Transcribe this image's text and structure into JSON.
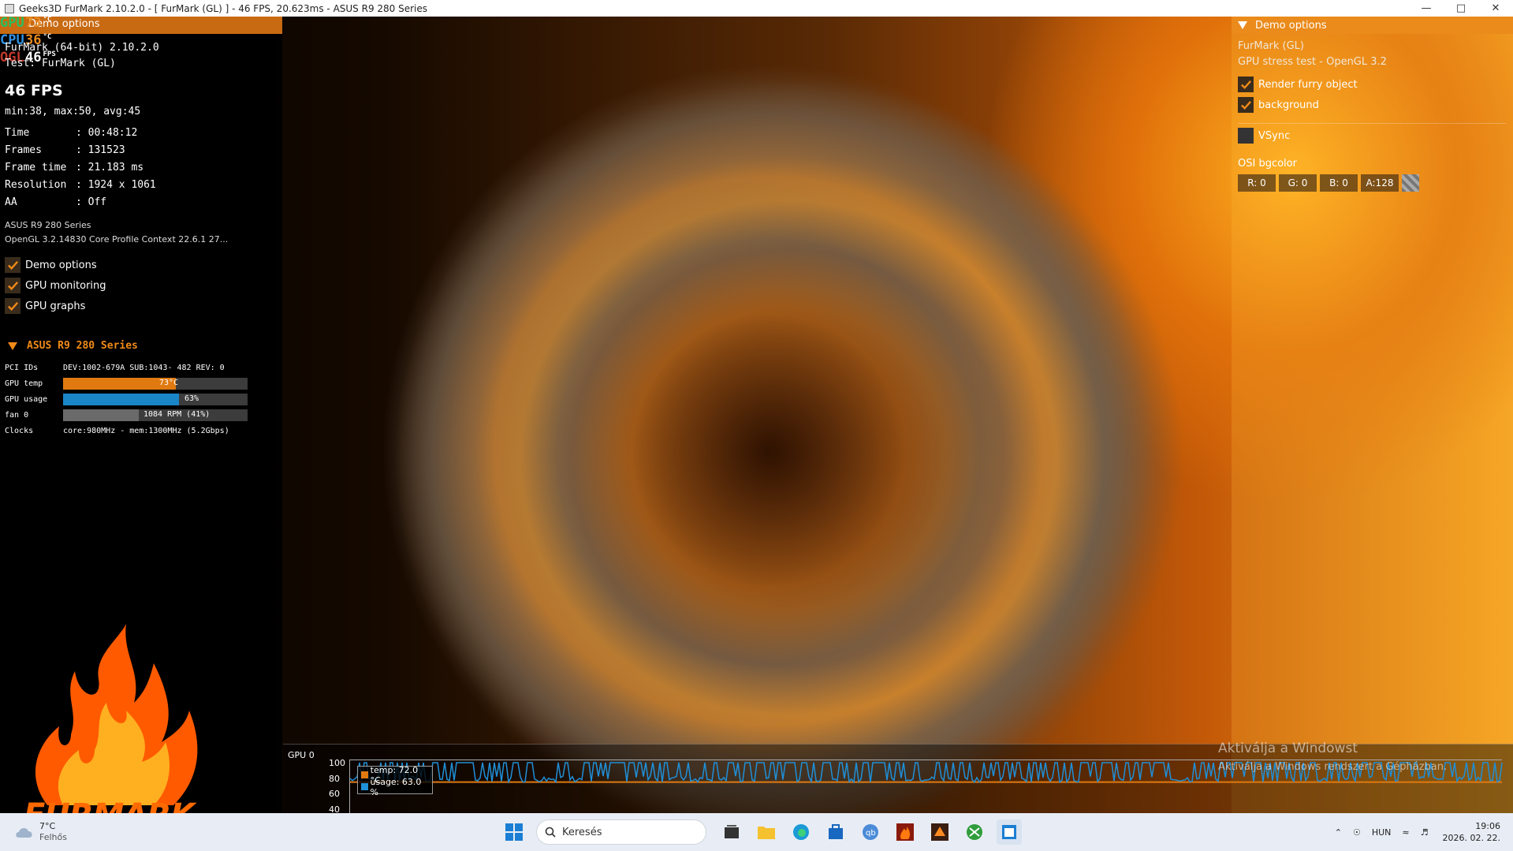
{
  "window": {
    "title": "Geeks3D FurMark 2.10.2.0 - [ FurMark (GL) ] - 46 FPS, 20.623ms - ASUS R9 280 Series",
    "minimize_icon": "minimize-icon",
    "maximize_icon": "maximize-icon",
    "close_icon": "close-icon"
  },
  "osd": {
    "gpu_label": "GPU",
    "gpu_value": "73",
    "gpu_unit": "°C",
    "cpu_label": "CPU",
    "cpu_value": "36",
    "cpu_unit": "°C",
    "ogl_label": "OGL",
    "ogl_value": "46",
    "ogl_unit": "FPS"
  },
  "left": {
    "demo_label": "Demo options",
    "version": "FurMark (64-bit) 2.10.2.0",
    "test": "Test: FurMark (GL)",
    "fps": "46 FPS",
    "minmax": "min:38, max:50, avg:45",
    "stats": [
      {
        "key": "Time",
        "value": ": 00:48:12"
      },
      {
        "key": "Frames",
        "value": ": 131523"
      },
      {
        "key": "Frame time",
        "value": ": 21.183 ms"
      },
      {
        "key": "Resolution",
        "value": ": 1924 x 1061"
      },
      {
        "key": "AA",
        "value": ": Off"
      }
    ],
    "gpu_name": "ASUS R9 280 Series",
    "opengl": "OpenGL 3.2.14830 Core Profile Context 22.6.1 27...",
    "checkboxes": [
      {
        "label": "Demo options",
        "checked": true
      },
      {
        "label": "GPU monitoring",
        "checked": true
      },
      {
        "label": "GPU graphs",
        "checked": true
      }
    ],
    "gpu_section": "ASUS R9 280 Series",
    "gpu_table": {
      "pci_label": "PCI IDs",
      "pci_value": "DEV:1002-679A SUB:1043- 482 REV: 0",
      "temp_label": "GPU temp",
      "temp_text": "73°C",
      "temp_fraction": 0.61,
      "usage_label": "GPU usage",
      "usage_text": "63%",
      "usage_fraction": 0.63,
      "fan_label": "fan 0",
      "fan_text": "1084 RPM (41%)",
      "fan_fraction": 0.41,
      "clocks_label": "Clocks",
      "clocks_value": "core:980MHz - mem:1300MHz (5.2Gbps)"
    },
    "logo_text": "FURMARK"
  },
  "right": {
    "header": "Demo options",
    "demo_name": "FurMark (GL)",
    "demo_desc": "GPU stress test - OpenGL 3.2",
    "render_furry": "Render furry object",
    "background": "background",
    "vsync": "VSync",
    "osi_bgcolor": "OSI bgcolor",
    "r": "R: 0",
    "g": "G: 0",
    "b": "B: 0",
    "a": "A:128"
  },
  "graph": {
    "label": "GPU 0",
    "y_ticks": [
      "100",
      "80",
      "60",
      "40"
    ],
    "legend_temp": "temp: 72.0 °C",
    "legend_usage": "usage: 63.0 %",
    "temp_color": "#e07a10",
    "usage_color": "#1f8fd8"
  },
  "watermark": {
    "line1": "Aktiválja a Windowst",
    "line2": "Aktiválja a Windows rendszert a Gépházban."
  },
  "taskbar": {
    "temp": "7°C",
    "weather": "Felhős",
    "search_placeholder": "Keresés",
    "lang": "HUN",
    "time": "19:06",
    "date": "2026. 02. 22."
  },
  "colors": {
    "accent": "#ea8b1c",
    "temp_bar": "#e07a10",
    "usage_bar": "#1a86c8",
    "fan_bar": "#6a6a6a"
  }
}
